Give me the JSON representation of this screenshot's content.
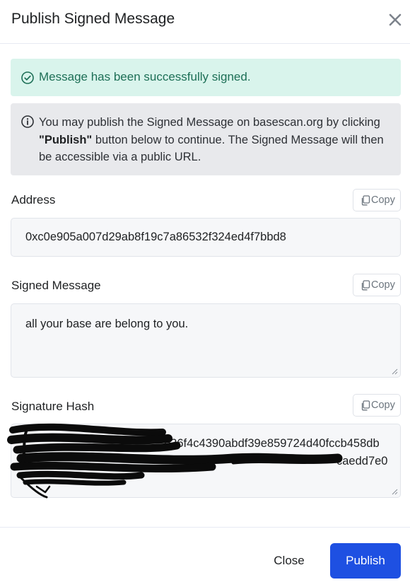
{
  "modal": {
    "title": "Publish Signed Message",
    "close_icon": "close-icon"
  },
  "alerts": {
    "success": {
      "text": "Message has been successfully signed.",
      "icon": "check-circle-icon",
      "color": "#d9f4ec"
    },
    "info": {
      "text_prefix": "You may publish the Signed Message on basescan.org by clicking ",
      "text_bold": "\"Publish\"",
      "text_suffix": " button below to continue. The Signed Message will then be accessible via a public URL.",
      "icon": "info-circle-icon",
      "color": "#e8e9ec"
    }
  },
  "fields": {
    "address": {
      "label": "Address",
      "value": "0xc0e905a007d29ab8f19c7a86532f324ed4f7bbd8",
      "copy_label": "Copy"
    },
    "signed_message": {
      "label": "Signed Message",
      "value": "all your base are belong to you.",
      "copy_label": "Copy"
    },
    "signature_hash": {
      "label": "Signature Hash",
      "visible_line1": "b36f4c4390abdf39e859724d40fccb458db",
      "visible_line2": "caedd7e0",
      "redacted_by": "hand-drawn scribble",
      "copy_label": "Copy"
    }
  },
  "footer": {
    "close_label": "Close",
    "publish_label": "Publish",
    "publish_color": "#1e50e2"
  }
}
